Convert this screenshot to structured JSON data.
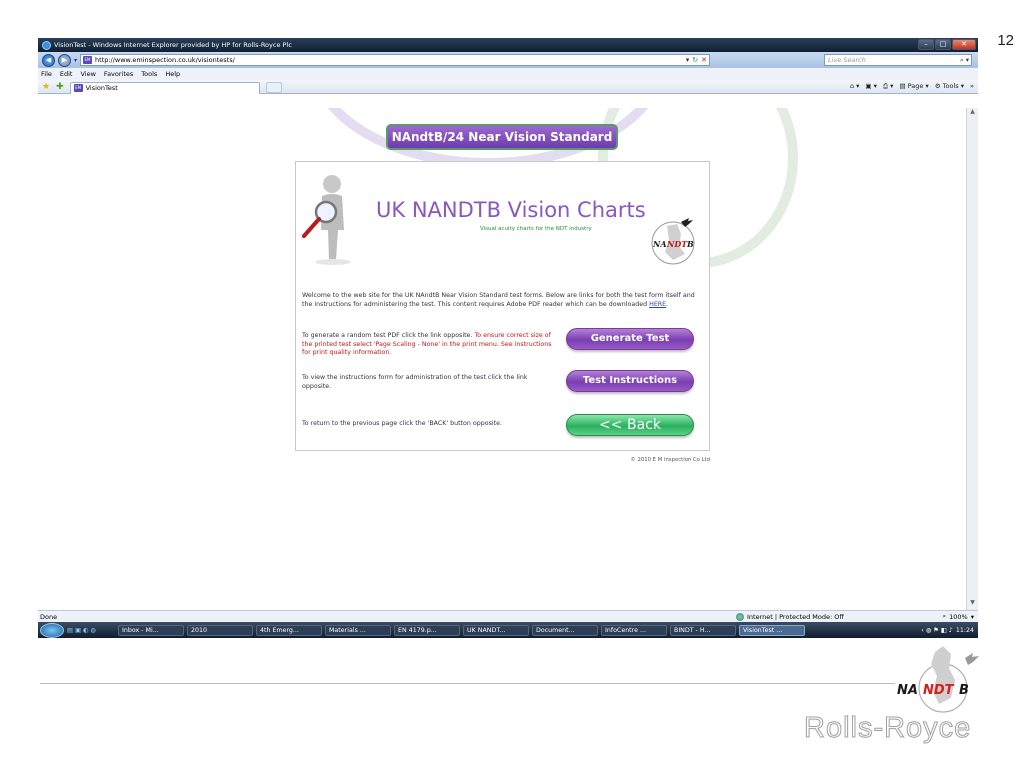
{
  "slide": {
    "page_number": "12"
  },
  "window": {
    "title": "VisionTest - Windows Internet Explorer provided by HP for Rolls-Royce Plc",
    "url": "http://www.eminspection.co.uk/visiontests/",
    "search_placeholder": "Live Search",
    "menu": [
      "File",
      "Edit",
      "View",
      "Favorites",
      "Tools",
      "Help"
    ],
    "tab_label": "VisionTest",
    "page_menu": "Page",
    "tools_menu": "Tools"
  },
  "page": {
    "header_banner": "NAndtB/24 Near Vision Standard",
    "title": "UK NANDTB Vision Charts",
    "subtitle": "Visual acuity charts for the NDT industry",
    "intro_text": "Welcome to the web site for the UK NAndtB Near Vision Standard test forms. Below are links for both the test form itself and the instructions for administering the test. This content requires Adobe PDF reader which can be downloaded ",
    "intro_link": "HERE",
    "row1_lead": "To generate a random test PDF click the link opposite. ",
    "row1_warning": "To ensure correct size of the printed test select 'Page Scaling - None' in the print menu. See instructions for print quality information.",
    "row2_text": "To view the instructions form for administration of the test click the link opposite.",
    "row3_text": "To return to the previous page click the 'BACK' button opposite.",
    "button_generate": "Generate Test",
    "button_instructions": "Test Instructions",
    "button_back": "<< Back",
    "copyright": "© 2010 E M Inspection Co Ltd",
    "logo_text_na": "NA",
    "logo_text_ndt": "NDT",
    "logo_text_b": "B"
  },
  "status": {
    "left": "Done",
    "zone": "Internet | Protected Mode: Off",
    "zoom": "100%"
  },
  "taskbar": {
    "items": [
      "Inbox - Mi...",
      "2010",
      "4th Emerg...",
      "Materials ...",
      "EN 4179.p...",
      "UK NANDT...",
      "Document...",
      "InfoCentre ...",
      "BINDT - H...",
      "VisionTest ..."
    ],
    "clock": "11:24"
  },
  "footer": {
    "logo_na": "NA",
    "logo_ndt": "NDT",
    "logo_b": "B",
    "brand": "Rolls-Royce"
  },
  "colors": {
    "accent_purple": "#8a56c0",
    "button_green": "#2ab060",
    "warning_red": "#c01818"
  }
}
